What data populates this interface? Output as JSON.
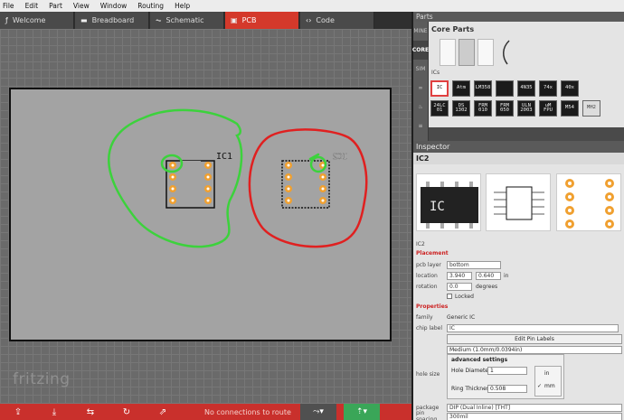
{
  "menu": [
    "File",
    "Edit",
    "Part",
    "View",
    "Window",
    "Routing",
    "Help"
  ],
  "tabs": [
    {
      "label": "Welcome",
      "icon": "f-logo-icon"
    },
    {
      "label": "Breadboard",
      "icon": "breadboard-icon"
    },
    {
      "label": "Schematic",
      "icon": "schematic-icon"
    },
    {
      "label": "PCB",
      "icon": "pcb-icon"
    },
    {
      "label": "Code",
      "icon": "code-icon"
    }
  ],
  "canvas": {
    "ic1_label": "IC1",
    "ic2_label": "IC2",
    "logo": "fritzing"
  },
  "bottom": {
    "status": "No connections to route"
  },
  "parts": {
    "title": "Parts",
    "bin_title": "Core Parts",
    "bins": [
      "MINE",
      "CORE",
      "SIM",
      "",
      "",
      ""
    ],
    "ics_label": "ICs",
    "chips_row1": [
      "IC",
      "Atm",
      "LM358",
      "",
      "4N35",
      "74x",
      "40x"
    ],
    "chips_row2": [
      "24LC\n01",
      "DS\n1302",
      "FRM\n010",
      "FRM\n050",
      "ULN\n2003",
      "uM\nFPU",
      "M54",
      "MH2"
    ]
  },
  "inspector": {
    "title": "Inspector",
    "part_name": "IC2",
    "ic_text": "IC",
    "part_id": "IC2",
    "placement_label": "Placement",
    "pcb_layer_label": "pcb layer",
    "pcb_layer_value": "bottom",
    "location_label": "location",
    "location_x": "3.940",
    "location_y": "0.640",
    "location_unit": "in",
    "rotation_label": "rotation",
    "rotation_value": "0.0",
    "rotation_unit": "degrees",
    "locked_label": "Locked",
    "properties_label": "Properties",
    "family_label": "family",
    "family_value": "Generic IC",
    "chip_label_label": "chip label",
    "chip_label_value": "IC",
    "edit_pins_label": "Edit Pin Labels",
    "trace_width_value": "Medium (1.0mm/0.0394in)",
    "advanced_label": "advanced settings",
    "hole_size_label": "hole size",
    "hole_diameter_label": "Hole Diameter",
    "hole_diameter_value": "1",
    "ring_thickness_label": "Ring Thickness",
    "ring_thickness_value": "0.508",
    "unit_in": "in",
    "unit_mm": "mm",
    "package_label": "package",
    "package_value": "DIP (Dual Inline) [THT]",
    "pin_spacing_label": "pin spacing",
    "pin_spacing_value": "300mil"
  }
}
